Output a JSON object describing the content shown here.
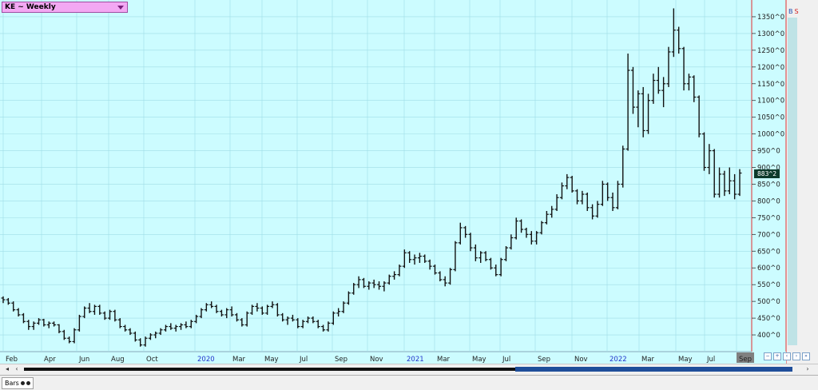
{
  "symbol_selector": {
    "label": "KE ~ Weekly"
  },
  "top_right_badge": {
    "left": "B",
    "right": "S",
    "left_color": "#1f4eb0",
    "right_color": "#d21f1f"
  },
  "last_price": "883^2",
  "chart_style": {
    "label": "Bars"
  },
  "colors": {
    "plot_bg": "#ccfcff",
    "grid": "#9fdde6",
    "bars": "#111111",
    "price_axis_line": "#e03030",
    "year_label": "#2233cc",
    "current_period_bg": "#808080"
  },
  "chart_data": {
    "type": "bar",
    "style": "ohlc",
    "title": "",
    "xlabel": "",
    "ylabel": "",
    "ylim": [
      350,
      1400
    ],
    "grid": true,
    "y_ticks": [
      {
        "value": 400,
        "label": "400^0"
      },
      {
        "value": 450,
        "label": "450^0"
      },
      {
        "value": 500,
        "label": "500^0"
      },
      {
        "value": 550,
        "label": "550^0"
      },
      {
        "value": 600,
        "label": "600^0"
      },
      {
        "value": 650,
        "label": "650^0"
      },
      {
        "value": 700,
        "label": "700^0"
      },
      {
        "value": 750,
        "label": "750^0"
      },
      {
        "value": 800,
        "label": "800^0"
      },
      {
        "value": 850,
        "label": "850^0"
      },
      {
        "value": 900,
        "label": "900^0"
      },
      {
        "value": 950,
        "label": "950^0"
      },
      {
        "value": 1000,
        "label": "1000^0"
      },
      {
        "value": 1050,
        "label": "1050^0"
      },
      {
        "value": 1100,
        "label": "1100^0"
      },
      {
        "value": 1150,
        "label": "1150^0"
      },
      {
        "value": 1200,
        "label": "1200^0"
      },
      {
        "value": 1250,
        "label": "1250^0"
      },
      {
        "value": 1300,
        "label": "1300^0"
      },
      {
        "value": 1350,
        "label": "1350^0"
      }
    ],
    "x_ticks": [
      {
        "label": "Feb",
        "year": false
      },
      {
        "label": "Apr",
        "year": false
      },
      {
        "label": "Jun",
        "year": false
      },
      {
        "label": "Aug",
        "year": false
      },
      {
        "label": "Oct",
        "year": false
      },
      {
        "label": "2020",
        "year": true
      },
      {
        "label": "Mar",
        "year": false
      },
      {
        "label": "May",
        "year": false
      },
      {
        "label": "Jul",
        "year": false
      },
      {
        "label": "Sep",
        "year": false
      },
      {
        "label": "Nov",
        "year": false
      },
      {
        "label": "2021",
        "year": true
      },
      {
        "label": "Mar",
        "year": false
      },
      {
        "label": "May",
        "year": false
      },
      {
        "label": "Jul",
        "year": false
      },
      {
        "label": "Sep",
        "year": false
      },
      {
        "label": "Nov",
        "year": false
      },
      {
        "label": "2022",
        "year": true
      },
      {
        "label": "Mar",
        "year": false
      },
      {
        "label": "May",
        "year": false
      },
      {
        "label": "Jul",
        "year": false
      },
      {
        "label": "Sep",
        "year": false,
        "current": true
      }
    ],
    "series": [
      {
        "ohlc": [
          [
            510,
            515,
            495,
            505
          ],
          [
            505,
            510,
            490,
            495
          ],
          [
            495,
            500,
            470,
            475
          ],
          [
            475,
            480,
            455,
            460
          ],
          [
            460,
            465,
            435,
            440
          ],
          [
            440,
            445,
            415,
            425
          ],
          [
            425,
            440,
            415,
            435
          ],
          [
            435,
            450,
            430,
            445
          ],
          [
            445,
            448,
            425,
            430
          ],
          [
            430,
            440,
            420,
            435
          ],
          [
            435,
            440,
            425,
            430
          ],
          [
            430,
            432,
            405,
            410
          ],
          [
            410,
            415,
            385,
            390
          ],
          [
            390,
            395,
            375,
            380
          ],
          [
            380,
            420,
            375,
            415
          ],
          [
            415,
            460,
            410,
            455
          ],
          [
            455,
            485,
            450,
            480
          ],
          [
            480,
            495,
            465,
            470
          ],
          [
            470,
            490,
            460,
            485
          ],
          [
            485,
            490,
            460,
            465
          ],
          [
            465,
            470,
            445,
            450
          ],
          [
            450,
            475,
            445,
            470
          ],
          [
            470,
            475,
            440,
            445
          ],
          [
            445,
            450,
            420,
            425
          ],
          [
            425,
            430,
            410,
            415
          ],
          [
            415,
            420,
            400,
            405
          ],
          [
            405,
            410,
            380,
            385
          ],
          [
            385,
            390,
            365,
            370
          ],
          [
            370,
            395,
            365,
            390
          ],
          [
            390,
            405,
            385,
            400
          ],
          [
            400,
            410,
            390,
            405
          ],
          [
            405,
            420,
            400,
            415
          ],
          [
            415,
            430,
            410,
            425
          ],
          [
            425,
            435,
            415,
            420
          ],
          [
            420,
            430,
            410,
            425
          ],
          [
            425,
            435,
            415,
            430
          ],
          [
            430,
            440,
            420,
            425
          ],
          [
            425,
            445,
            420,
            440
          ],
          [
            440,
            460,
            435,
            455
          ],
          [
            455,
            480,
            450,
            475
          ],
          [
            475,
            495,
            470,
            490
          ],
          [
            490,
            500,
            480,
            485
          ],
          [
            485,
            490,
            465,
            470
          ],
          [
            470,
            475,
            455,
            460
          ],
          [
            460,
            480,
            450,
            475
          ],
          [
            475,
            485,
            455,
            460
          ],
          [
            460,
            465,
            440,
            445
          ],
          [
            445,
            450,
            425,
            430
          ],
          [
            430,
            470,
            425,
            465
          ],
          [
            465,
            490,
            460,
            485
          ],
          [
            485,
            495,
            470,
            480
          ],
          [
            480,
            485,
            460,
            465
          ],
          [
            465,
            490,
            460,
            485
          ],
          [
            485,
            500,
            480,
            490
          ],
          [
            490,
            495,
            455,
            460
          ],
          [
            460,
            465,
            440,
            445
          ],
          [
            445,
            455,
            430,
            450
          ],
          [
            450,
            460,
            440,
            445
          ],
          [
            445,
            450,
            420,
            425
          ],
          [
            425,
            445,
            420,
            440
          ],
          [
            440,
            455,
            435,
            450
          ],
          [
            450,
            455,
            435,
            440
          ],
          [
            440,
            445,
            420,
            425
          ],
          [
            425,
            430,
            410,
            415
          ],
          [
            415,
            440,
            410,
            435
          ],
          [
            435,
            470,
            430,
            465
          ],
          [
            465,
            480,
            455,
            470
          ],
          [
            470,
            500,
            465,
            495
          ],
          [
            495,
            530,
            490,
            525
          ],
          [
            525,
            555,
            520,
            550
          ],
          [
            550,
            575,
            540,
            565
          ],
          [
            565,
            570,
            540,
            545
          ],
          [
            545,
            560,
            535,
            555
          ],
          [
            555,
            565,
            540,
            550
          ],
          [
            550,
            560,
            535,
            545
          ],
          [
            545,
            560,
            530,
            555
          ],
          [
            555,
            580,
            550,
            575
          ],
          [
            575,
            590,
            565,
            580
          ],
          [
            580,
            610,
            575,
            605
          ],
          [
            605,
            655,
            600,
            645
          ],
          [
            645,
            650,
            615,
            625
          ],
          [
            625,
            640,
            610,
            630
          ],
          [
            630,
            645,
            615,
            635
          ],
          [
            635,
            640,
            615,
            620
          ],
          [
            620,
            625,
            595,
            605
          ],
          [
            605,
            610,
            580,
            585
          ],
          [
            585,
            590,
            560,
            565
          ],
          [
            565,
            575,
            545,
            555
          ],
          [
            555,
            600,
            550,
            595
          ],
          [
            595,
            680,
            590,
            675
          ],
          [
            675,
            735,
            670,
            720
          ],
          [
            720,
            725,
            690,
            700
          ],
          [
            700,
            705,
            650,
            660
          ],
          [
            660,
            670,
            620,
            630
          ],
          [
            630,
            650,
            615,
            645
          ],
          [
            645,
            650,
            620,
            625
          ],
          [
            625,
            630,
            595,
            600
          ],
          [
            600,
            610,
            575,
            580
          ],
          [
            580,
            630,
            575,
            625
          ],
          [
            625,
            665,
            620,
            660
          ],
          [
            660,
            700,
            655,
            690
          ],
          [
            690,
            750,
            685,
            740
          ],
          [
            740,
            745,
            705,
            715
          ],
          [
            715,
            720,
            690,
            700
          ],
          [
            700,
            710,
            670,
            680
          ],
          [
            680,
            710,
            670,
            705
          ],
          [
            705,
            740,
            700,
            735
          ],
          [
            735,
            770,
            730,
            760
          ],
          [
            760,
            785,
            750,
            775
          ],
          [
            775,
            820,
            770,
            810
          ],
          [
            810,
            855,
            805,
            845
          ],
          [
            845,
            880,
            835,
            870
          ],
          [
            870,
            875,
            825,
            830
          ],
          [
            830,
            835,
            790,
            800
          ],
          [
            800,
            830,
            790,
            820
          ],
          [
            820,
            825,
            770,
            780
          ],
          [
            780,
            790,
            745,
            755
          ],
          [
            755,
            800,
            750,
            790
          ],
          [
            790,
            860,
            785,
            850
          ],
          [
            850,
            855,
            800,
            810
          ],
          [
            810,
            825,
            770,
            780
          ],
          [
            780,
            860,
            775,
            850
          ],
          [
            850,
            965,
            840,
            955
          ],
          [
            955,
            1240,
            950,
            1190
          ],
          [
            1190,
            1200,
            1060,
            1080
          ],
          [
            1080,
            1130,
            1020,
            1120
          ],
          [
            1120,
            1140,
            990,
            1010
          ],
          [
            1010,
            1120,
            1000,
            1100
          ],
          [
            1100,
            1180,
            1090,
            1160
          ],
          [
            1160,
            1200,
            1120,
            1130
          ],
          [
            1130,
            1170,
            1080,
            1150
          ],
          [
            1150,
            1260,
            1140,
            1245
          ],
          [
            1245,
            1375,
            1230,
            1310
          ],
          [
            1310,
            1320,
            1240,
            1255
          ],
          [
            1255,
            1260,
            1130,
            1150
          ],
          [
            1150,
            1180,
            1130,
            1170
          ],
          [
            1170,
            1175,
            1095,
            1110
          ],
          [
            1110,
            1115,
            990,
            1000
          ],
          [
            1000,
            1005,
            890,
            900
          ],
          [
            900,
            970,
            880,
            950
          ],
          [
            950,
            955,
            810,
            820
          ],
          [
            820,
            900,
            810,
            880
          ],
          [
            880,
            890,
            815,
            830
          ],
          [
            830,
            900,
            820,
            860
          ],
          [
            860,
            880,
            805,
            820
          ],
          [
            820,
            895,
            815,
            883.25
          ]
        ]
      }
    ]
  }
}
